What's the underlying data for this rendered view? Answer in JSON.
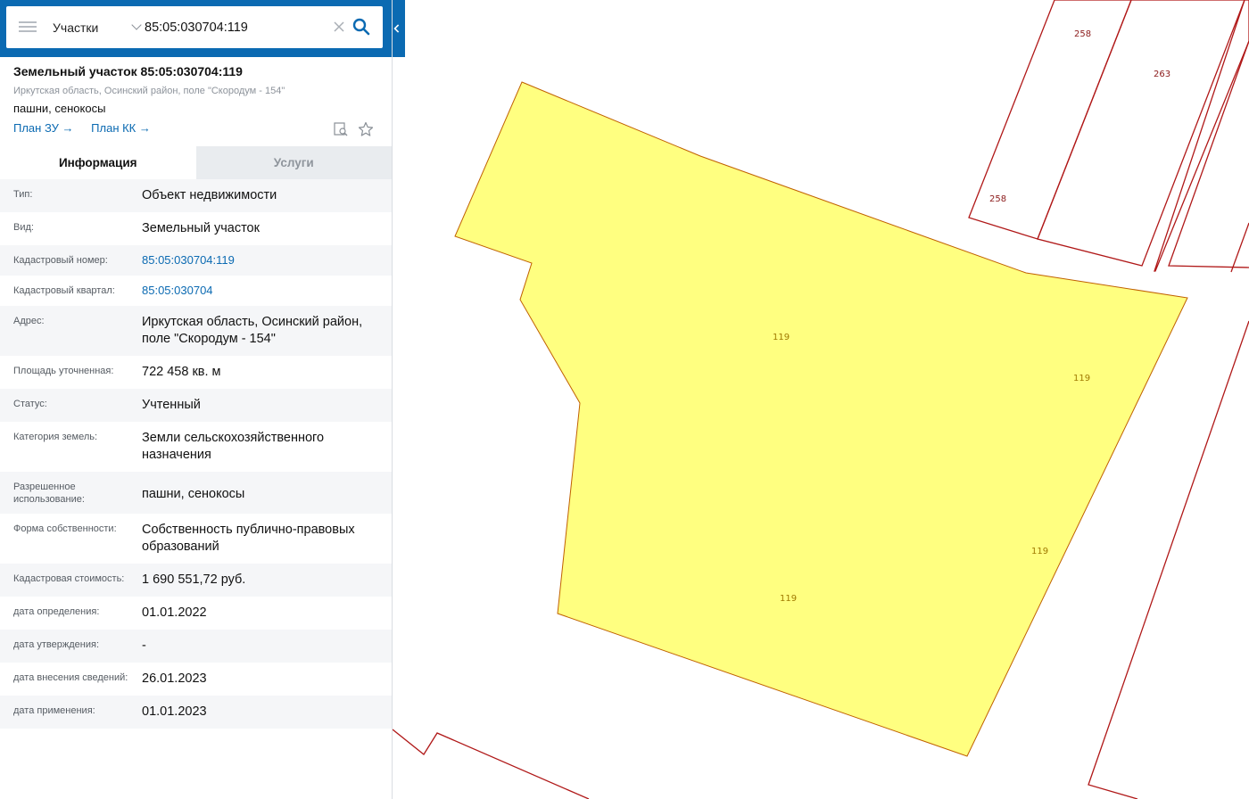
{
  "search": {
    "layer": "Участки",
    "query": "85:05:030704:119"
  },
  "object": {
    "title": "Земельный участок 85:05:030704:119",
    "address": "Иркутская область, Осинский район, поле \"Скородум - 154\"",
    "use": "пашни, сенокосы",
    "links": [
      "План ЗУ →",
      "План КК →"
    ]
  },
  "tabs": [
    {
      "label": "Информация",
      "active": true
    },
    {
      "label": "Услуги",
      "active": false
    }
  ],
  "info": [
    {
      "key": "Тип:",
      "value": "Объект недвижимости"
    },
    {
      "key": "Вид:",
      "value": "Земельный участок"
    },
    {
      "key": "Кадастровый номер:",
      "value": "85:05:030704:119",
      "link": true
    },
    {
      "key": "Кадастровый квартал:",
      "value": "85:05:030704",
      "link": true
    },
    {
      "key": "Адрес:",
      "value": "Иркутская область, Осинский район, поле \"Скородум - 154\""
    },
    {
      "key": "Площадь уточненная:",
      "value": "722 458 кв. м"
    },
    {
      "key": "Статус:",
      "value": "Учтенный"
    },
    {
      "key": "Категория земель:",
      "value": "Земли сельскохозяйственного назначения"
    },
    {
      "key": "Разрешенное использование:",
      "value": "пашни, сенокосы"
    },
    {
      "key": "Форма собственности:",
      "value": "Собственность публично-правовых образований"
    },
    {
      "key": "Кадастровая стоимость:",
      "value": "1 690 551,72 руб."
    },
    {
      "key": "дата определения:",
      "value": "01.01.2022"
    },
    {
      "key": "дата утверждения:",
      "value": "-"
    },
    {
      "key": "дата внесения сведений:",
      "value": "26.01.2023"
    },
    {
      "key": "дата применения:",
      "value": "01.01.2023"
    }
  ],
  "map": {
    "selected_parcel_label": "119",
    "neighbor_labels": [
      "258",
      "263",
      "258"
    ],
    "colors": {
      "selected_fill": "#ffff80",
      "selected_stroke": "#c06000",
      "parcel_stroke": "#b01818",
      "accent": "#0b6ab2"
    }
  }
}
